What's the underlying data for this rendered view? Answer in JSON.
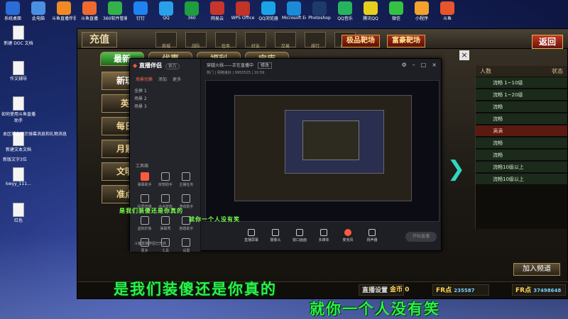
{
  "desktop": {
    "top_icons": [
      {
        "label": "系统桌面",
        "color": "#2b6cd6"
      },
      {
        "label": "此电脑",
        "color": "#4a90e2"
      },
      {
        "label": "斗鱼直播伴侣",
        "color": "#f08a24"
      },
      {
        "label": "斗鱼直播",
        "color": "#ee6a2e"
      },
      {
        "label": "360软件管家",
        "color": "#33b24a"
      },
      {
        "label": "钉钉",
        "color": "#1e82f0"
      },
      {
        "label": "QQ",
        "color": "#2aa0ea"
      },
      {
        "label": "360",
        "color": "#1e9e3e"
      },
      {
        "label": "网易云",
        "color": "#c8352b"
      },
      {
        "label": "WPS Office",
        "color": "#c23328"
      },
      {
        "label": "QQ浏览器",
        "color": "#19a3e8"
      },
      {
        "label": "Microsoft Edge",
        "color": "#1b8bd8"
      },
      {
        "label": "Photoshop",
        "color": "#1d3a6c"
      },
      {
        "label": "QQ音乐",
        "color": "#26b55c"
      },
      {
        "label": "腾讯QQ",
        "color": "#e8ce1c"
      },
      {
        "label": "微信",
        "color": "#34c244"
      },
      {
        "label": "小程序",
        "color": "#f2a22d"
      },
      {
        "label": "斗鱼",
        "color": "#e8542b"
      }
    ],
    "left_icons": [
      {
        "label": "新建 DOC 文档"
      },
      {
        "label": "作文辅导"
      },
      {
        "label": "如何使用斗鱼直播助手"
      },
      {
        "label": "新建文本文档"
      },
      {
        "label": "kwyy_111..."
      },
      {
        "label": "红色"
      }
    ],
    "left_text": "本区域会显示弹幕消息和礼物消息",
    "left_text2": "新版文字3位"
  },
  "game": {
    "recharge": "充值",
    "nav": [
      "商城",
      "战队",
      "任务",
      "好友",
      "交易",
      "排行",
      "邮件"
    ],
    "btn_rank": "极品靶场",
    "btn_fame": "富豪靶场",
    "back": "返回",
    "tabs": [
      {
        "label": "最新",
        "active": true
      },
      {
        "label": "优惠",
        "active": false
      },
      {
        "label": "福利",
        "active": false
      },
      {
        "label": "宝库",
        "active": false
      }
    ],
    "side": [
      {
        "label": "新玩",
        "active": true
      },
      {
        "label": "英",
        "active": false
      },
      {
        "label": "每日",
        "active": false
      },
      {
        "label": "月累",
        "active": false
      },
      {
        "label": "文明",
        "active": false
      },
      {
        "label": "准点",
        "active": false
      }
    ],
    "rooms_header": [
      "人数",
      "状态"
    ],
    "rooms": [
      {
        "label": "流畅 1~10级",
        "red": false
      },
      {
        "label": "流畅 1~20级",
        "red": false
      },
      {
        "label": "流畅",
        "red": false
      },
      {
        "label": "流畅",
        "red": false
      },
      {
        "label": "满满",
        "red": true
      },
      {
        "label": "流畅",
        "red": false
      },
      {
        "label": "流畅",
        "red": false
      },
      {
        "label": "流畅10级以上",
        "red": false
      },
      {
        "label": "流畅10级以上",
        "red": false
      }
    ],
    "join": "加入频道",
    "gold_label": "金币",
    "gold_value": "0",
    "fr_label": "FR点",
    "fr_value": "235587",
    "fr2_label": "FR点",
    "fr2_value": "37498648",
    "footer_btn": "直播设置",
    "close": "×"
  },
  "streamer": {
    "app_name": "直播伴侣",
    "version": "官方",
    "side_tabs": [
      {
        "label": "场景切换",
        "on": true
      },
      {
        "label": "添加",
        "on": false
      },
      {
        "label": "更多",
        "on": false
      }
    ],
    "scene": [
      "全屏 1",
      "场景 2",
      "场景 3"
    ],
    "tools_label": "工具箱",
    "tools": [
      {
        "label": "弹幕助手",
        "red": true
      },
      {
        "label": "房管助手",
        "red": false
      },
      {
        "label": "主播任务",
        "red": false
      },
      {
        "label": "投屏直播",
        "red": false
      },
      {
        "label": "点点技能",
        "red": false
      },
      {
        "label": "游戏助手",
        "red": false
      },
      {
        "label": "虚拟形象",
        "red": false
      },
      {
        "label": "弹幕秀",
        "red": false
      },
      {
        "label": "答题助手",
        "red": false
      },
      {
        "label": "更多",
        "red": false
      },
      {
        "label": "工具",
        "red": false
      },
      {
        "label": "设置",
        "red": false
      }
    ],
    "side_bottom": "斗鱼直播伴侣已开启",
    "title": "穿越火线——正在直播中",
    "title_tag": "修改",
    "info": "热门 | 网络良好 | 9953525 | 10:59",
    "controls": [
      "直播屏幕",
      "摄像头",
      "窗口画面",
      "多媒体",
      "麦克风",
      "扬声器"
    ],
    "start": "开始直播",
    "overlay1": "是我们装傻还是你真的",
    "overlay2": "就你一个人没有笑"
  },
  "subtitles": {
    "line1": "是我们装傻还是你真的",
    "line2": "就你一个人没有笑"
  }
}
